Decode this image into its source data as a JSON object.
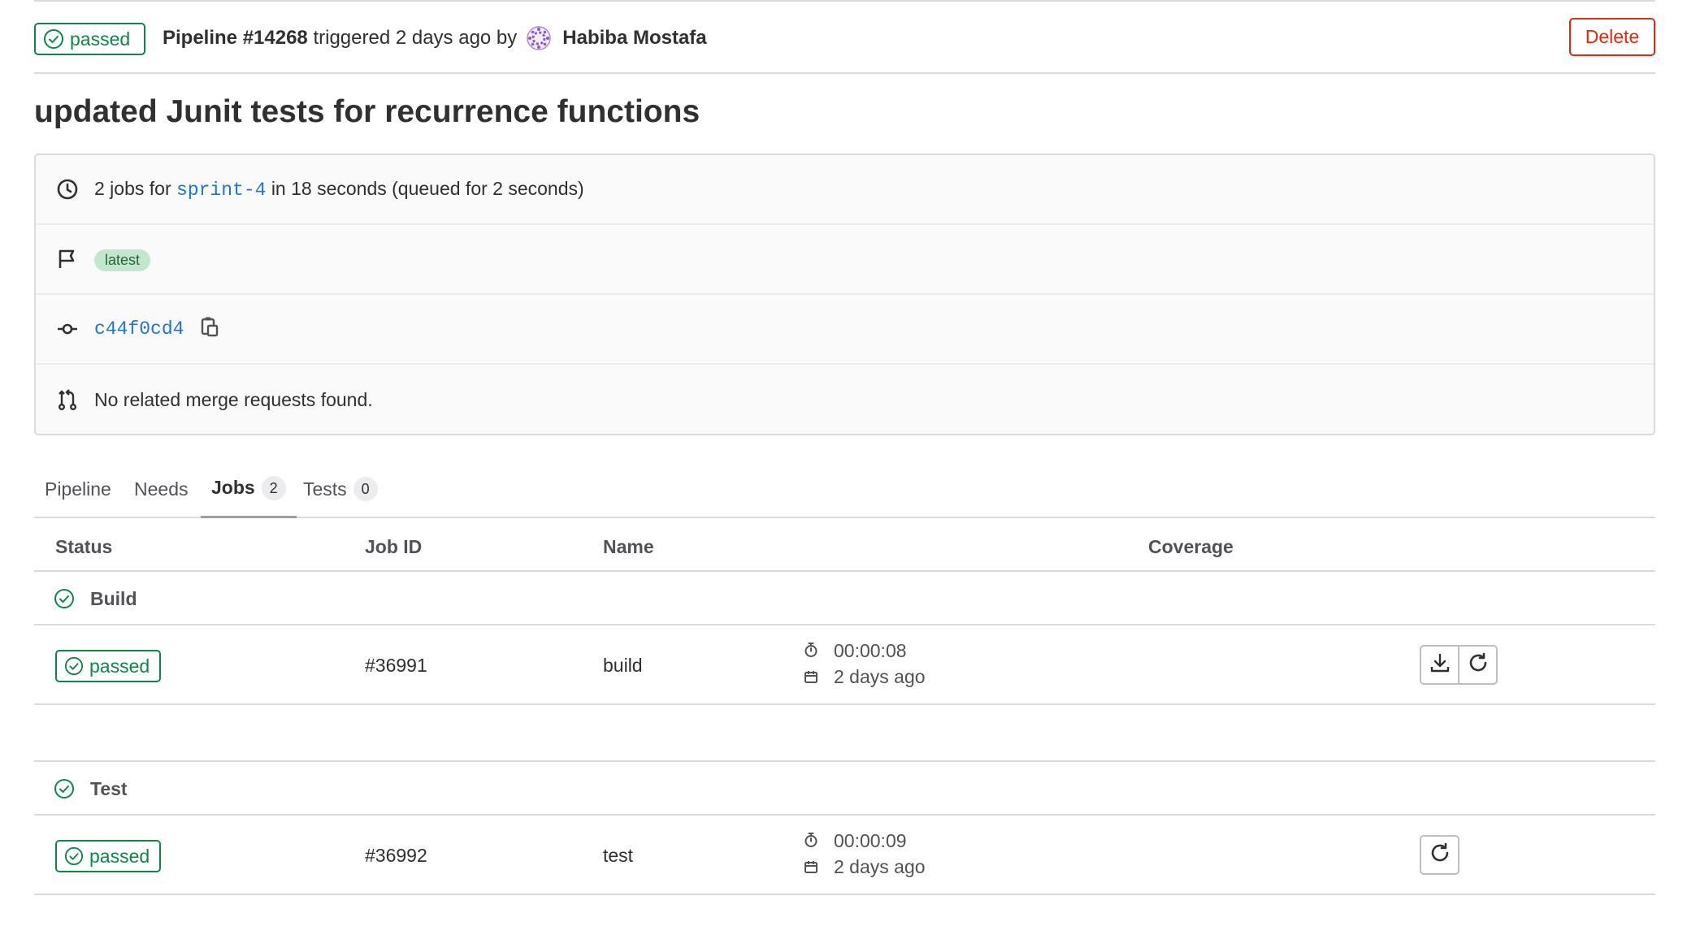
{
  "header": {
    "status": "passed",
    "pipeline_label": "Pipeline #14268",
    "triggered_text": "triggered 2 days ago by",
    "user_name": "Habiba Mostafa",
    "delete_label": "Delete"
  },
  "title": "updated Junit tests for recurrence functions",
  "info": {
    "jobs_prefix": "2 jobs for",
    "branch": "sprint-4",
    "jobs_suffix": "in 18 seconds (queued for 2 seconds)",
    "tag": "latest",
    "commit_sha": "c44f0cd4",
    "merge_requests": "No related merge requests found."
  },
  "tabs": [
    {
      "label": "Pipeline"
    },
    {
      "label": "Needs"
    },
    {
      "label": "Jobs",
      "count": "2"
    },
    {
      "label": "Tests",
      "count": "0"
    }
  ],
  "table": {
    "headers": [
      "Status",
      "Job ID",
      "Name",
      "Coverage"
    ],
    "stages": [
      {
        "name": "Build",
        "jobs": [
          {
            "status": "passed",
            "id": "#36991",
            "name": "build",
            "duration": "00:00:08",
            "finished": "2 days ago"
          }
        ]
      },
      {
        "name": "Test",
        "jobs": [
          {
            "status": "passed",
            "id": "#36992",
            "name": "test",
            "duration": "00:00:09",
            "finished": "2 days ago"
          }
        ]
      }
    ]
  },
  "colors": {
    "success": "#108548",
    "danger": "#dd2b0e",
    "link": "#1f75cb"
  }
}
